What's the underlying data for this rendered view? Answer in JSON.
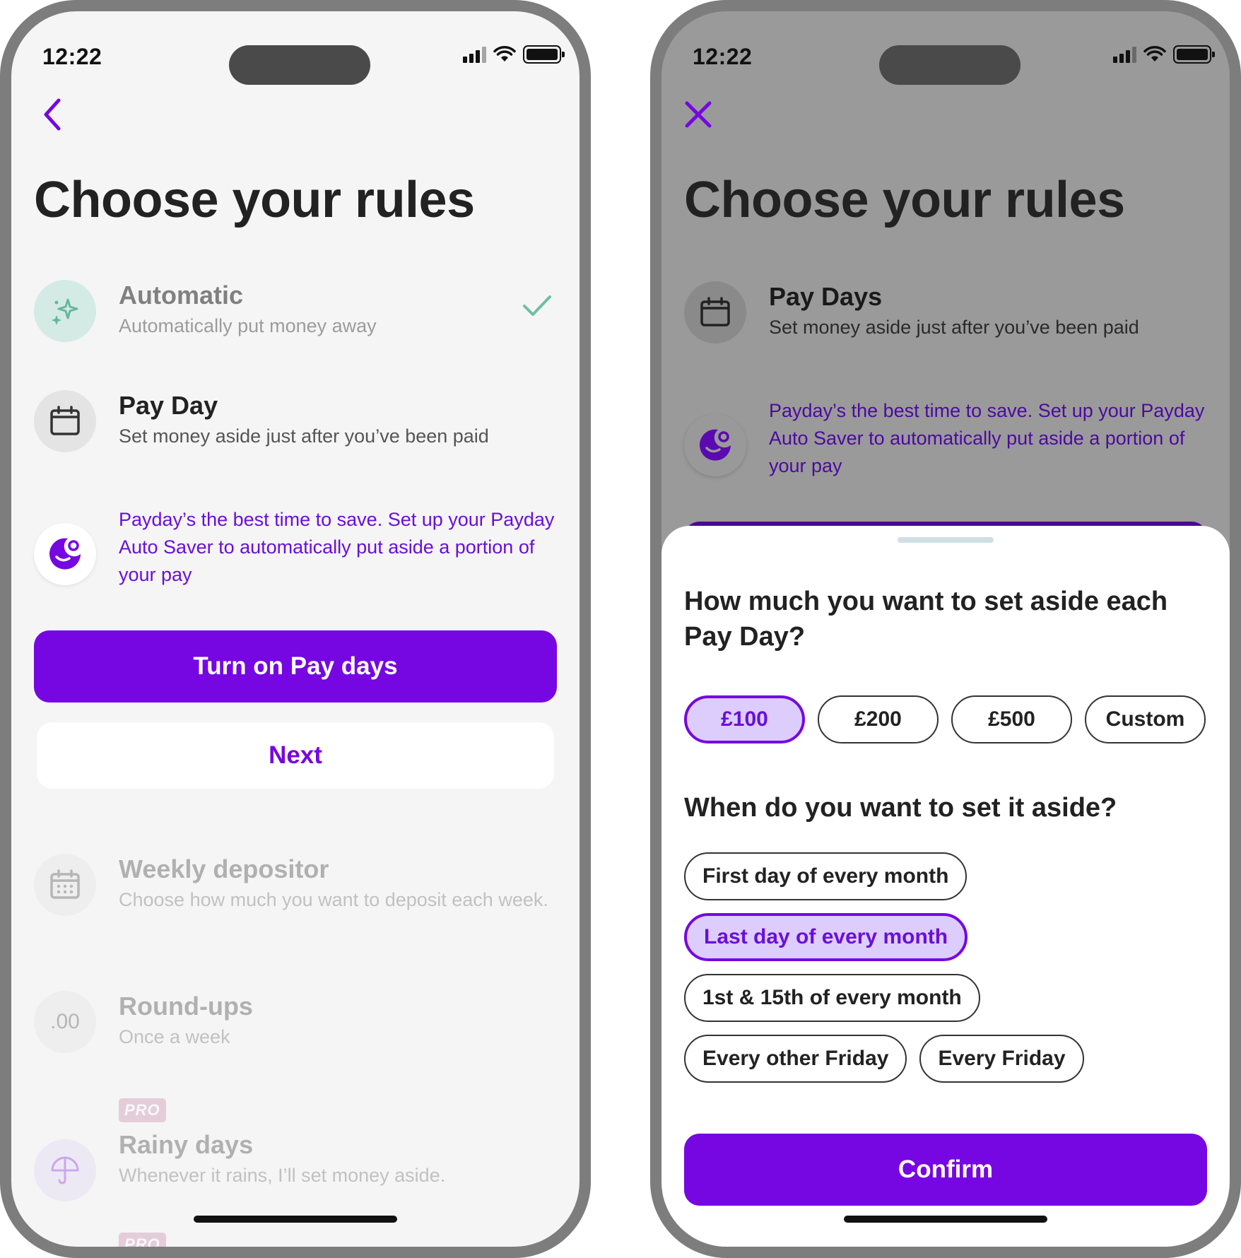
{
  "colors": {
    "accent": "#7607e2",
    "accent_light": "#dccdfc",
    "promo_text": "#6a0fd8",
    "check": "#6dbfa4"
  },
  "status_bar": {
    "time": "12:22"
  },
  "left_screen": {
    "nav_icon": "back-chevron-icon",
    "title": "Choose your rules",
    "rules": [
      {
        "title": "Automatic",
        "subtitle": "Automatically put money away",
        "icon": "sparkle-icon",
        "checked": true
      },
      {
        "title": "Pay Day",
        "subtitle": "Set money aside just after you’ve been paid",
        "icon": "calendar-icon"
      }
    ],
    "promo": {
      "text": "Payday’s the best time to save. Set up your Payday Auto Saver to automatically put aside a portion of your pay",
      "icon": "payday-moon-icon"
    },
    "primary_button": "Turn on Pay days",
    "secondary_button": "Next",
    "more_rules": [
      {
        "title": "Weekly depositor",
        "subtitle": "Choose how much you want to deposit each week.",
        "icon": "calendar-dots-icon"
      },
      {
        "title": "Round-ups",
        "subtitle": "Once a week",
        "icon_text": ".00"
      },
      {
        "badge": "PRO",
        "title": "Rainy days",
        "subtitle": "Whenever it rains, I’ll set money aside.",
        "icon": "umbrella-icon"
      },
      {
        "badge": "PRO"
      }
    ]
  },
  "right_screen": {
    "nav_icon": "close-icon",
    "title": "Choose your rules",
    "rule": {
      "title": "Pay Days",
      "subtitle": "Set money aside just after you’ve been paid",
      "icon": "calendar-icon"
    },
    "promo": {
      "text": "Payday’s the best time to save. Set up your Payday Auto Saver to automatically put aside a portion of your pay",
      "icon": "payday-moon-icon"
    },
    "sheet": {
      "amount_question": "How much you want to set aside each Pay Day?",
      "amounts": [
        "£100",
        "£200",
        "£500",
        "Custom"
      ],
      "selected_amount": "£100",
      "when_question": "When do you want to set it aside?",
      "day_options": [
        "First day of every month",
        "Last day of every month",
        "1st & 15th of every month",
        "Every other Friday",
        "Every Friday"
      ],
      "selected_day": "Last day of every month",
      "confirm_button": "Confirm"
    }
  }
}
